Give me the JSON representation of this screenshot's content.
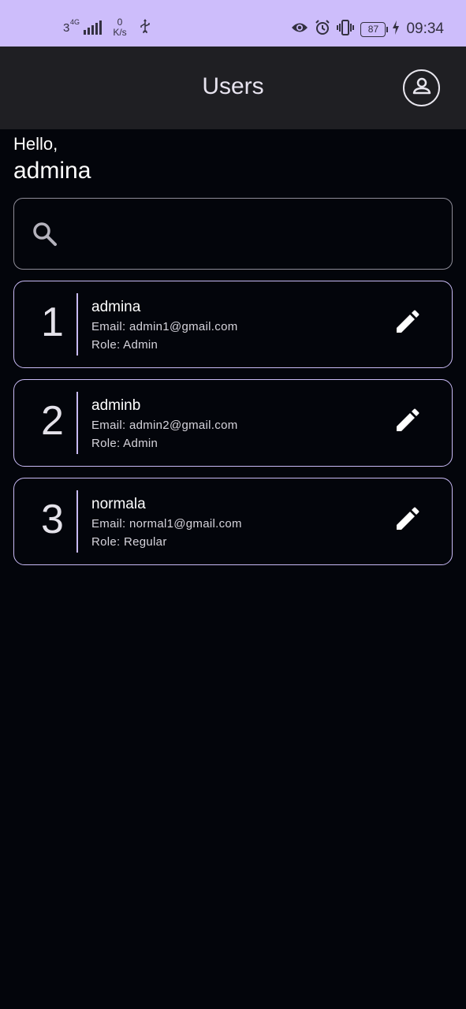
{
  "status_bar": {
    "network": "3",
    "network_type": "4G",
    "speed_value": "0",
    "speed_unit": "K/s",
    "battery": "87",
    "time": "09:34",
    "icons": [
      "usb-icon",
      "eye-icon",
      "alarm-icon",
      "vibrate-icon",
      "battery-icon",
      "charging-icon"
    ]
  },
  "app_bar": {
    "title": "Users",
    "account_icon": "account-circle-icon"
  },
  "greeting": {
    "hello": "Hello,",
    "name": "admina"
  },
  "search": {
    "icon": "search-icon",
    "value": "",
    "placeholder": ""
  },
  "users": [
    {
      "index": "1",
      "name": "admina",
      "email": "Email: admin1@gmail.com",
      "role": "Role: Admin"
    },
    {
      "index": "2",
      "name": "adminb",
      "email": "Email: admin2@gmail.com",
      "role": "Role: Admin"
    },
    {
      "index": "3",
      "name": "normala",
      "email": "Email: normal1@gmail.com",
      "role": "Role: Regular"
    }
  ],
  "colors": {
    "status_bar_bg": "#cdbdfb",
    "app_bar_bg": "#1f1f23",
    "background": "#03050b",
    "card_border": "#c8baf5"
  }
}
